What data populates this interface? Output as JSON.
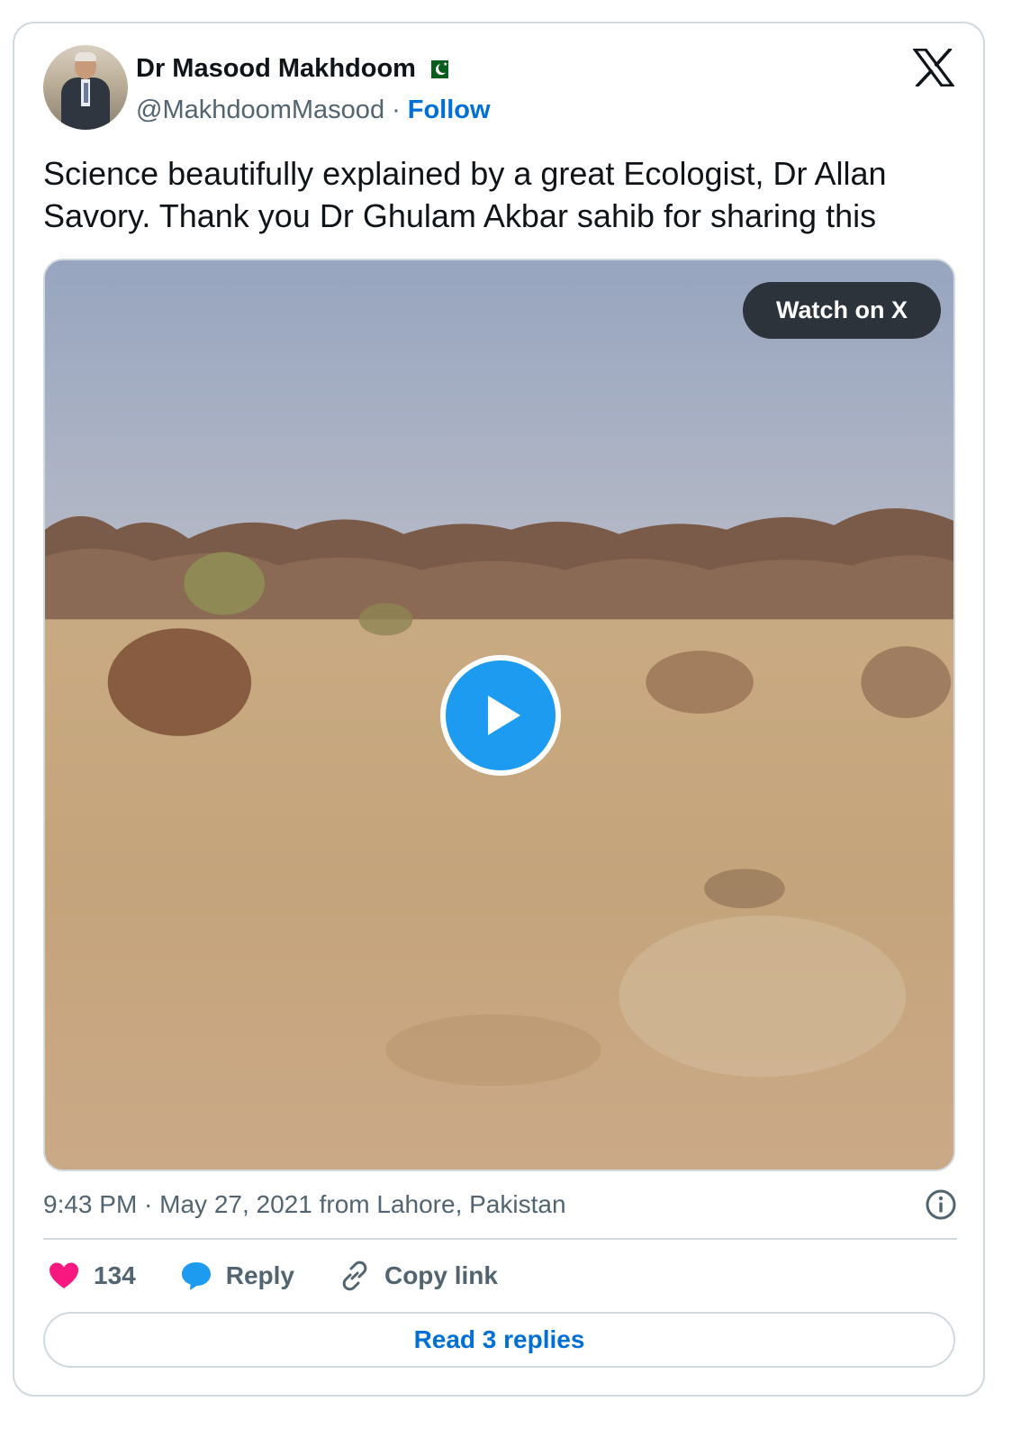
{
  "author": {
    "name": "Dr Masood Makhdoom",
    "handle": "@MakhdoomMasood",
    "separator": "·",
    "follow_label": "Follow",
    "badge": "pakistan-flag"
  },
  "tweet": {
    "text": "Science beautifully explained by a great Ecologist, Dr Allan Savory. Thank you Dr Ghulam Akbar sahib for sharing this"
  },
  "media": {
    "watch_label": "Watch on X",
    "play_icon": "play-icon"
  },
  "meta": {
    "timestamp": "9:43 PM · May 27, 2021 from Lahore, Pakistan",
    "info_icon": "info-icon"
  },
  "actions": {
    "like_count": "134",
    "reply_label": "Reply",
    "copy_label": "Copy link"
  },
  "read_replies_label": "Read 3 replies",
  "colors": {
    "link_blue": "#006fd6",
    "play_blue": "#1d9bf0",
    "like_pink": "#f91880",
    "reply_blue": "#1d9bf0",
    "muted": "#536471",
    "border": "#cfd9de"
  }
}
